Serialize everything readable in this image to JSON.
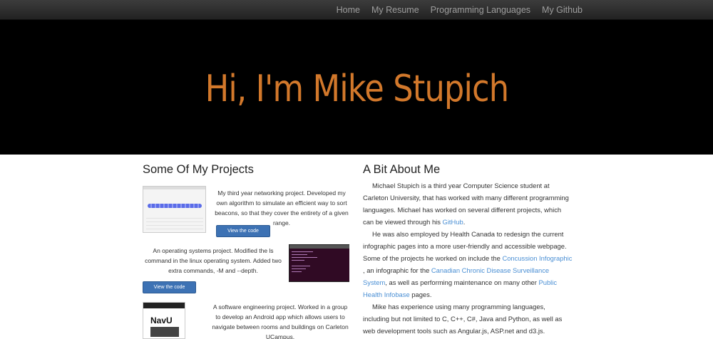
{
  "nav": {
    "items": [
      {
        "label": "Home"
      },
      {
        "label": "My Resume"
      },
      {
        "label": "Programming Languages"
      },
      {
        "label": "My Github"
      }
    ]
  },
  "hero": {
    "title": "Hi, I'm Mike Stupich"
  },
  "projects": {
    "title": "Some Of My Projects",
    "items": [
      {
        "description": "My third year networking project. Developed my own algorithm to simulate an efficient way to sort beacons, so that they cover the entirety of a given range.",
        "button": "View the code"
      },
      {
        "description": "An operating systems project. Modified the ls command in the linux operating system. Added two extra commands, -M and --depth.",
        "button": "View the code"
      },
      {
        "description": "A software engineering project. Worked in a group to develop an Android app which allows users to navigate between rooms and buildings on Carleton UCampus.",
        "thumb_logo": "NavU"
      }
    ]
  },
  "about": {
    "title": "A Bit About Me",
    "p1_before": "Michael Stupich is a third year Computer Science student at Carleton University, that has worked with many different programming languages. Michael has worked on several different projects, which can be viewed through his ",
    "p1_link": "GitHub",
    "p1_after": ".",
    "p2_before": "He was also employed by Health Canada to redesign the current infographic pages into a more user-friendly and accessible webpage. Some of the projects he worked on include the ",
    "p2_link1": "Concussion Infographic",
    "p2_mid1": " , an infographic for the ",
    "p2_link2": "Canadian Chronic Disease Surveillance System",
    "p2_mid2": ", as well as performing maintenance on many other ",
    "p2_link3": "Public Health Infobase",
    "p2_after": " pages.",
    "p3": "Mike has experience using many programming languages, including but not limited to C, C++, C#, Java and Python, as well as web development tools such as Angular.js, ASP.net and d3.js."
  },
  "colors": {
    "accent": "#d2782b",
    "link": "#4a8fd4",
    "button": "#3d72b4",
    "navbar": "#222222"
  }
}
